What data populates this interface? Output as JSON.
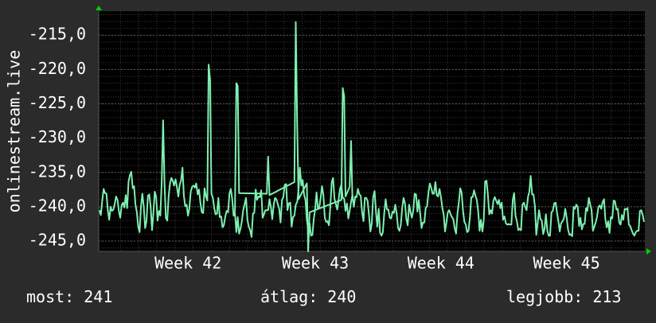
{
  "chart_data": {
    "type": "line",
    "ylabel": "onlinestream.live",
    "x_tick_labels": [
      "Week 42",
      "Week 43",
      "Week 44",
      "Week 45"
    ],
    "y_ticks": [
      -215,
      -220,
      -225,
      -230,
      -235,
      -240,
      -245
    ],
    "y_tick_labels": [
      "-215,0",
      "-220,0",
      "-225,0",
      "-230,0",
      "-235,0",
      "-240,0",
      "-245,0"
    ],
    "ylim": [
      -246.5,
      -211.5
    ],
    "grid": true,
    "series": [
      {
        "color": "#7ef0b0",
        "values": [
          -240.5,
          -241.2,
          -239.0,
          -237.4,
          -238.0,
          -238.1,
          -240.5,
          -241.9,
          -240.0,
          -240.6,
          -240.4,
          -239.6,
          -238.5,
          -239.0,
          -240.6,
          -241.6,
          -239.8,
          -239.4,
          -240.1,
          -238.3,
          -240.2,
          -236.3,
          -235.4,
          -234.9,
          -237.3,
          -237.0,
          -239.6,
          -240.8,
          -242.9,
          -243.7,
          -239.9,
          -238.1,
          -240.0,
          -243.1,
          -242.1,
          -238.4,
          -238.2,
          -239.9,
          -243.4,
          -240.9,
          -237.8,
          -238.6,
          -242.0,
          -240.6,
          -241.3,
          -236.5,
          -227.4,
          -236.5,
          -241.6,
          -242.0,
          -238.5,
          -236.6,
          -235.8,
          -236.2,
          -236.9,
          -236.0,
          -237.1,
          -238.5,
          -236.8,
          -236.2,
          -234.3,
          -238.3,
          -239.9,
          -239.7,
          -241.3,
          -240.3,
          -237.8,
          -237.1,
          -236.9,
          -237.2,
          -236.6,
          -238.2,
          -237.5,
          -239.4,
          -240.8,
          -240.9,
          -237.3,
          -238.5,
          -239.1,
          -219.3,
          -221.5,
          -238.1,
          -238.7,
          -240.2,
          -241.1,
          -241.0,
          -238.7,
          -241.5,
          -241.4,
          -243.0,
          -242.7,
          -241.4,
          -240.6,
          -240.8,
          -238.1,
          -237.4,
          -238.9,
          -241.3,
          -240.9,
          -243.7,
          -241.5,
          -243.9,
          -243.2,
          -242.1,
          -240.5,
          -239.6,
          -238.7,
          -241.9,
          -242.9,
          -243.4,
          -244.4,
          -241.0,
          -240.9,
          -237.5,
          -239.0,
          -238.5,
          -238.6,
          -237.6,
          -241.6,
          -241.1,
          -240.5,
          -240.5,
          -240.5,
          -238.9,
          -240.1,
          -241.8,
          -239.8,
          -238.7,
          -238.9,
          -239.6,
          -240.3,
          -242.3,
          -239.0,
          -238.6,
          -236.8,
          -236.7,
          -240.5,
          -239.5,
          -239.4,
          -242.9,
          -241.5,
          -241.3,
          -239.7,
          -239.3,
          -237.5,
          -234.3,
          -236.9,
          -236.1,
          -238.2,
          -239.0,
          -241.9,
          -243.3,
          -242.4,
          -244.2,
          -244.1,
          -241.8,
          -240.4,
          -237.9,
          -240.3,
          -240.1,
          -238.7,
          -237.0,
          -238.3,
          -241.6,
          -242.2,
          -242.1,
          -242.7,
          -240.0,
          -236.4,
          -235.8,
          -238.8,
          -239.6,
          -240.4,
          -239.0,
          -237.4,
          -236.8,
          -238.7,
          -238.8,
          -240.6,
          -239.5,
          -241.7,
          -240.6,
          -239.3,
          -238.3,
          -240.0,
          -238.5,
          -238.6,
          -237.4,
          -238.2,
          -238.4,
          -240.8,
          -242.1,
          -238.7,
          -238.7,
          -239.2,
          -241.2,
          -243.6,
          -242.4,
          -238.6,
          -237.7,
          -240.6,
          -242.9,
          -240.3,
          -243.8,
          -244.2,
          -243.7,
          -241.0,
          -238.9,
          -240.4,
          -240.4,
          -241.6,
          -241.7,
          -240.7,
          -240.9,
          -239.7,
          -240.9,
          -243.1,
          -243.5,
          -242.6,
          -240.2,
          -238.7,
          -239.5,
          -241.8,
          -242.7,
          -239.7,
          -240.7,
          -241.6,
          -240.6,
          -238.1,
          -238.2,
          -240.7,
          -239.0,
          -241.0,
          -243.1,
          -242.3,
          -242.3,
          -240.2,
          -239.9,
          -237.9,
          -236.6,
          -237.2,
          -238.1,
          -238.1,
          -236.4,
          -238.3,
          -238.5,
          -237.4,
          -238.5,
          -240.1,
          -241.1,
          -243.6,
          -242.3,
          -240.8,
          -240.5,
          -241.1,
          -241.5,
          -241.8,
          -243.2,
          -243.9,
          -241.0,
          -239.3,
          -237.3,
          -237.9,
          -240.6,
          -242.2,
          -242.6,
          -243.7,
          -243.5,
          -241.5,
          -238.6,
          -238.6,
          -237.6,
          -238.4,
          -239.0,
          -240.7,
          -243.5,
          -241.9,
          -243.6,
          -242.0,
          -236.3,
          -236.2,
          -238.2,
          -241.1,
          -240.5,
          -241.0,
          -239.1,
          -238.6,
          -239.1,
          -239.6,
          -239.0,
          -240.2,
          -239.4,
          -241.9,
          -241.4,
          -242.4,
          -242.6,
          -242.5,
          -242.6,
          -242.6,
          -239.0,
          -238.0,
          -241.3,
          -242.1,
          -243.4,
          -243.2,
          -243.4,
          -239.7,
          -239.4,
          -240.0,
          -240.5,
          -238.6,
          -237.8,
          -235.5,
          -238.2,
          -238.2,
          -239.9,
          -244.1,
          -242.4,
          -240.5,
          -241.8,
          -242.0,
          -244.0,
          -243.2,
          -241.1,
          -243.5,
          -244.2,
          -244.2,
          -240.8,
          -240.6,
          -239.5,
          -239.4,
          -240.8,
          -242.1,
          -243.6,
          -242.4,
          -242.1,
          -241.7,
          -240.3,
          -241.6,
          -243.3,
          -244.1,
          -244.0,
          -244.3,
          -240.0,
          -240.3,
          -239.7,
          -240.0,
          -242.8,
          -241.6,
          -243.3,
          -242.5,
          -242.5,
          -240.2,
          -240.6,
          -238.7,
          -239.6,
          -240.4,
          -243.5,
          -242.9,
          -242.3,
          -241.4,
          -240.0,
          -239.8,
          -240.3,
          -239.3,
          -238.9,
          -241.8,
          -243.0,
          -242.1,
          -243.8,
          -241.5,
          -241.7,
          -239.1,
          -239.2,
          -240.4,
          -240.3,
          -242.3,
          -242.6,
          -241.2,
          -241.9,
          -240.3,
          -240.4,
          -240.2,
          -242.6,
          -242.8,
          -243.4,
          -243.9,
          -244.2,
          -243.7,
          -243.5,
          -243.5,
          -240.6,
          -240.5,
          -241.2,
          -242.2
        ]
      },
      {
        "color": "#7ef0b0",
        "points": [
          [
            98,
            -240.8
          ],
          [
            99,
            -222.0
          ],
          [
            100,
            -222.4
          ],
          [
            101,
            -238.0
          ],
          [
            121,
            -238.1
          ],
          [
            122,
            -232.7
          ],
          [
            123,
            -238.3
          ],
          [
            141,
            -236.4
          ],
          [
            142,
            -213.1
          ],
          [
            143,
            -228.0
          ],
          [
            144,
            -238.9
          ],
          [
            150,
            -236.6
          ],
          [
            151,
            -246.5
          ],
          [
            152,
            -240.8
          ],
          [
            175,
            -239.0
          ],
          [
            176,
            -222.7
          ],
          [
            177,
            -223.9
          ],
          [
            178,
            -238.5
          ],
          [
            181,
            -237.1
          ],
          [
            182,
            -230.4
          ],
          [
            183,
            -238.9
          ]
        ]
      }
    ]
  },
  "stats": {
    "current": "most: 241",
    "average": "átlag: 240",
    "best": "legjobb: 213"
  },
  "colors": {
    "background": "#2b2b2b",
    "plot_background": "#000000",
    "grid": "#3a3a3a",
    "axis_arrow": "#00d000",
    "text": "#ffffff"
  }
}
